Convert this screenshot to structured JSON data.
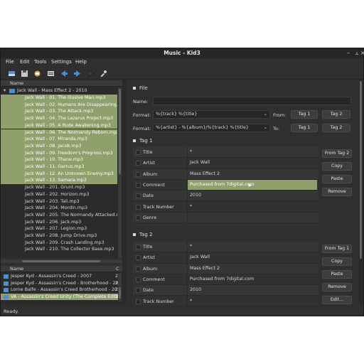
{
  "window": {
    "title": "Music - Kid3"
  },
  "menu": [
    "File",
    "Edit",
    "Tools",
    "Settings",
    "Help"
  ],
  "toolbar": [
    "open-icon",
    "save-icon",
    "revert-icon",
    "playlist-icon",
    "previous-icon",
    "next-icon",
    "play-icon",
    "settings-icon"
  ],
  "file_tree": {
    "header": "Name",
    "folder": "Jack Wall - Mass Effect 2 - 2010",
    "files": [
      {
        "name": "Jack Wall - 01. The Illusive Man.mp3",
        "selected": true
      },
      {
        "name": "Jack Wall - 02. Humans Are Disappearing.mp3",
        "selected": true
      },
      {
        "name": "Jack Wall - 03. The Attack.mp3",
        "selected": true
      },
      {
        "name": "Jack Wall - 04. The Lazarus Project.mp3",
        "selected": true
      },
      {
        "name": "Jack Wall - 05. A Rude Awakening.mp3",
        "selected": true
      },
      {
        "name": "Jack Wall - 06. The Normandy Reborn.mp3",
        "selected": true
      },
      {
        "name": "Jack Wall - 07. Miranda.mp3",
        "selected": true
      },
      {
        "name": "Jack Wall - 08. Jacob.mp3",
        "selected": true
      },
      {
        "name": "Jack Wall - 09. Freedom's Progress.mp3",
        "selected": true
      },
      {
        "name": "Jack Wall - 10. Thane.mp3",
        "selected": true
      },
      {
        "name": "Jack Wall - 11. Garrus.mp3",
        "selected": true
      },
      {
        "name": "Jack Wall - 12. An Unknown Enemy.mp3",
        "selected": true
      },
      {
        "name": "Jack Wall - 13. Samara.mp3",
        "selected": true
      },
      {
        "name": "Jack Wall - 201. Grunt.mp3",
        "selected": false
      },
      {
        "name": "Jack Wall - 202. Horizon.mp3",
        "selected": false
      },
      {
        "name": "Jack Wall - 203. Tali.mp3",
        "selected": false
      },
      {
        "name": "Jack Wall - 204. Mordin.mp3",
        "selected": false
      },
      {
        "name": "Jack Wall - 205. The Normandy Attacked.mp3",
        "selected": false
      },
      {
        "name": "Jack Wall - 206. Jack.mp3",
        "selected": false
      },
      {
        "name": "Jack Wall - 207. Legion.mp3",
        "selected": false
      },
      {
        "name": "Jack Wall - 208. Jump Drive.mp3",
        "selected": false
      },
      {
        "name": "Jack Wall - 209. Crash Landing.mp3",
        "selected": false
      },
      {
        "name": "Jack Wall - 210. The Collector Base.mp3",
        "selected": false
      }
    ]
  },
  "dir_list": {
    "header_name": "Name",
    "header_c": "C",
    "items": [
      {
        "name": "Jesper Kyd - Assassin's Creed - 2007",
        "count": "2",
        "selected": false
      },
      {
        "name": "Jesper Kyd - Assassin's Creed - Brotherhood - 2010",
        "count": "2",
        "selected": false
      },
      {
        "name": "Lorne Balfe - Assassin's Creed Brotherhood - 2010",
        "count": "2",
        "selected": false
      },
      {
        "name": "VA - Assassin's Creed Unity (The Complete Edition)",
        "count": "2",
        "selected": true
      }
    ]
  },
  "file_section": {
    "title": "File",
    "name_label": "Name:",
    "name_value": "",
    "format1_label": "Format:",
    "format1_value": "%{track} %{title}",
    "from_label": "From:",
    "format2_label": "Format:",
    "format2_value": "%{artist} - %{album}/%{track} %{title}",
    "to_label": "To:",
    "tag1_btn": "Tag 1",
    "tag2_btn": "Tag 2"
  },
  "tag1": {
    "title": "Tag 1",
    "rows": [
      {
        "name": "Title",
        "value": "*"
      },
      {
        "name": "Artist",
        "value": "Jack Wall"
      },
      {
        "name": "Album",
        "value": "Mass Effect 2"
      },
      {
        "name": "Comment",
        "value": "Purchased from 7digital.com",
        "editing": true
      },
      {
        "name": "Date",
        "value": "2010"
      },
      {
        "name": "Track Number",
        "value": "*"
      },
      {
        "name": "Genre",
        "value": ""
      }
    ],
    "buttons": [
      "From Tag 2",
      "Copy",
      "Paste",
      "Remove"
    ]
  },
  "tag2": {
    "title": "Tag 2",
    "rows": [
      {
        "name": "Title",
        "value": "*"
      },
      {
        "name": "Artist",
        "value": "Jack Wall"
      },
      {
        "name": "Album",
        "value": "Mass Effect 2"
      },
      {
        "name": "Comment",
        "value": "Purchased from 7digital.com"
      },
      {
        "name": "Date",
        "value": "2010"
      },
      {
        "name": "Track Number",
        "value": "*"
      }
    ],
    "buttons": [
      "From Tag 1",
      "Copy",
      "Paste",
      "Remove",
      "Edit..."
    ]
  },
  "status": "Ready.",
  "colors": {
    "selection": "#8fa06c",
    "background": "#2f2f2f",
    "folder_icon": "#4a8fd6"
  }
}
